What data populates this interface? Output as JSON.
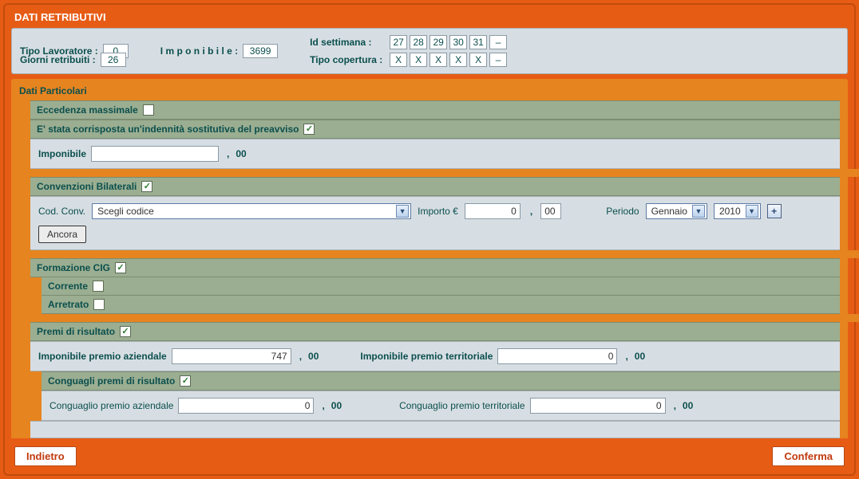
{
  "title": "DATI RETRIBUTIVI",
  "info": {
    "tipo_lavoratore_label": "Tipo Lavoratore :",
    "tipo_lavoratore_value": "0",
    "giorni_label": "Giorni  retribuiti :",
    "giorni_value": "26",
    "imponibile_label": "I m p o n i b i l e :",
    "imponibile_value": "3699",
    "id_settimana_label": "Id settimana :",
    "weeks": [
      "27",
      "28",
      "29",
      "30",
      "31",
      "–"
    ],
    "tipo_copertura_label": "Tipo copertura :",
    "coverage": [
      "X",
      "X",
      "X",
      "X",
      "X",
      "–"
    ]
  },
  "sections": {
    "dati_particolari": "Dati Particolari",
    "eccedenza": "Eccedenza massimale",
    "indennita": "E' stata corrisposta un'indennità sostitutiva del preavviso",
    "imponibile_label": "Imponibile",
    "imponibile_suffix": "00",
    "convenzioni": "Convenzioni Bilaterali",
    "cod_conv_label": "Cod. Conv.",
    "cod_conv_value": "Scegli codice",
    "importo_label": "Importo €",
    "importo_value": "0",
    "importo_suffix": "00",
    "periodo_label": "Periodo",
    "periodo_mese": "Gennaio",
    "periodo_anno": "2010",
    "ancora": "Ancora",
    "formazione": "Formazione CIG",
    "corrente": "Corrente",
    "arretrato": "Arretrato",
    "premi": "Premi di risultato",
    "imp_premio_az_label": "Imponibile premio aziendale",
    "imp_premio_az_value": "747",
    "imp_premio_terr_label": "Imponibile premio territoriale",
    "imp_premio_terr_value": "0",
    "conguagli": "Conguagli premi di risultato",
    "cong_az_label": "Conguaglio premio aziendale",
    "cong_az_value": "0",
    "cong_terr_label": "Conguaglio premio territoriale",
    "cong_terr_value": "0",
    "suffix00": "00"
  },
  "footer": {
    "indietro": "Indietro",
    "conferma": "Conferma"
  }
}
